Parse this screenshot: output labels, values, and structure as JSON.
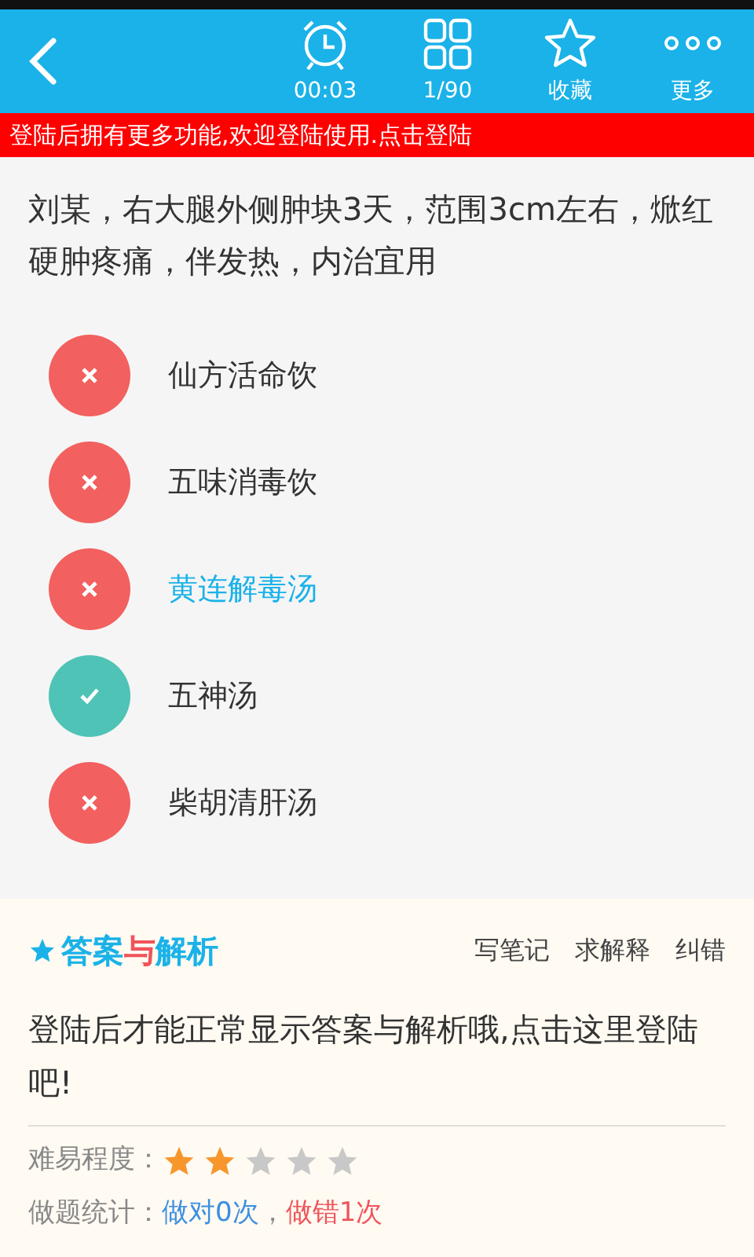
{
  "toolbar": {
    "items": [
      {
        "kind": "timer",
        "label": "00:03"
      },
      {
        "kind": "grid",
        "label": "1/90"
      },
      {
        "kind": "star",
        "label": "收藏"
      },
      {
        "kind": "more",
        "label": "更多"
      }
    ]
  },
  "login_banner": "登陆后拥有更多功能,欢迎登陆使用.点击登陆",
  "question": "刘某，右大腿外侧肿块3天，范围3cm左右，焮红硬肿疼痛，伴发热，内治宜用",
  "options": [
    {
      "text": "仙方活命饮",
      "correct": false,
      "selected": false
    },
    {
      "text": "五味消毒饮",
      "correct": false,
      "selected": false
    },
    {
      "text": "黄连解毒汤",
      "correct": false,
      "selected": true
    },
    {
      "text": "五神汤",
      "correct": true,
      "selected": false
    },
    {
      "text": "柴胡清肝汤",
      "correct": false,
      "selected": false
    }
  ],
  "answer_section": {
    "logo_parts": [
      {
        "text": "答案",
        "color": "#1ab2e8"
      },
      {
        "text": "与",
        "color": "#f0545a"
      },
      {
        "text": "解析",
        "color": "#1ab2e8"
      }
    ],
    "actions": [
      "写笔记",
      "求解释",
      "纠错"
    ],
    "message": "登陆后才能正常显示答案与解析哦,点击这里登陆吧!",
    "difficulty_label": "难易程度：",
    "stars": 2,
    "stats_label": "做题统计：",
    "stats_right": "做对0次",
    "stats_sep": "，",
    "stats_wrong": "做错1次"
  }
}
